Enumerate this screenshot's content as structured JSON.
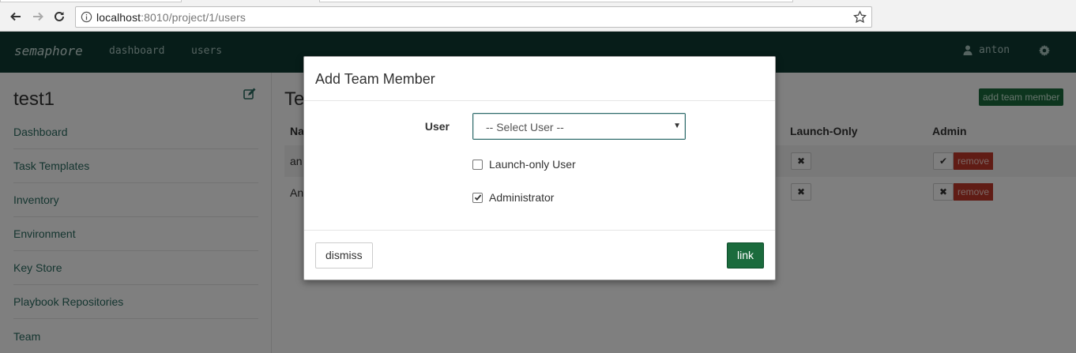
{
  "browser": {
    "url_host": "localhost",
    "url_rest": ":8010/project/1/users"
  },
  "navbar": {
    "brand": "semaphore",
    "links": [
      "dashboard",
      "users"
    ],
    "user": "anton",
    "bg_color": "#0f3a33"
  },
  "sidebar": {
    "project_title": "test1",
    "items": [
      {
        "label": "Dashboard"
      },
      {
        "label": "Task Templates"
      },
      {
        "label": "Inventory"
      },
      {
        "label": "Environment"
      },
      {
        "label": "Key Store"
      },
      {
        "label": "Playbook Repositories"
      },
      {
        "label": "Team"
      }
    ]
  },
  "main": {
    "title_partial": "Te",
    "add_member_label": "add team member",
    "columns": {
      "name": "Na",
      "launch_only": "Launch-Only",
      "admin": "Admin"
    },
    "rows": [
      {
        "name": "an",
        "launch_only": "✖",
        "admin": "✔",
        "remove": "remove"
      },
      {
        "name": "An",
        "launch_only": "✖",
        "admin": "✖",
        "remove": "remove"
      }
    ]
  },
  "modal": {
    "title": "Add Team Member",
    "user_label": "User",
    "user_select_value": "-- Select User --",
    "launch_only_label": "Launch-only User",
    "launch_only_checked": false,
    "admin_label": "Administrator",
    "admin_checked": true,
    "dismiss_label": "dismiss",
    "link_label": "link",
    "accent": "#1b6b3d"
  }
}
